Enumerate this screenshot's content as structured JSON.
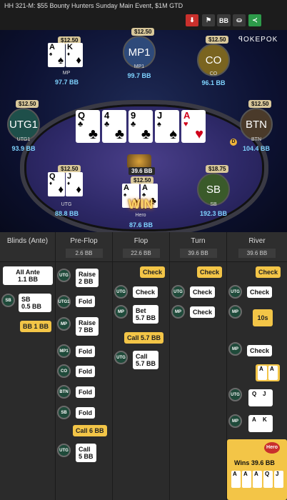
{
  "window": {
    "title": "HH  321-M: $55 Bounty Hunters Sunday Main Event, $1M GTD"
  },
  "toolbar": {
    "bb_label": "BB",
    "brand": "ꟼOKEPOK"
  },
  "players": [
    {
      "pos": "MP",
      "stack": "$12.50",
      "bb": "97.7 BB"
    },
    {
      "pos": "MP1",
      "stack": "$12.50",
      "bb": "99.7 BB"
    },
    {
      "pos": "CO",
      "stack": "$12.50",
      "bb": "96.1 BB"
    },
    {
      "pos": "UTG1",
      "stack": "$12.50",
      "bb": "93.9 BB"
    },
    {
      "pos": "BTN",
      "stack": "$12.50",
      "bb": "104.4 BB"
    },
    {
      "pos": "UTG",
      "stack": "$12.50",
      "bb": "88.8 BB"
    },
    {
      "pos": "Hero",
      "stack": "$12.50",
      "bb": "87.6 BB"
    },
    {
      "pos": "SB",
      "stack": "$18.75",
      "bb": "192.3 BB"
    }
  ],
  "dealer": "D",
  "pot": "39.6 BB",
  "win": "WIN",
  "board": [
    {
      "r": "Q",
      "s": "♣"
    },
    {
      "r": "4",
      "s": "♣"
    },
    {
      "r": "9",
      "s": "♣"
    },
    {
      "r": "J",
      "s": "♠"
    },
    {
      "r": "A",
      "s": "♥"
    }
  ],
  "streets": [
    {
      "name": "Blinds (Ante)",
      "pot": ""
    },
    {
      "name": "Pre-Flop",
      "pot": "2.6 BB"
    },
    {
      "name": "Flop",
      "pot": "22.6 BB"
    },
    {
      "name": "Turn",
      "pot": "39.6 BB"
    },
    {
      "name": "River",
      "pot": "39.6 BB"
    }
  ],
  "blinds": {
    "all_ante": "All Ante\n1.1 BB",
    "sb_chip": "SB",
    "sb": "SB\n0.5 BB",
    "bb": "BB 1 BB"
  },
  "preflop": [
    {
      "chip": "UTG",
      "act": "Raise\n2 BB"
    },
    {
      "chip": "UTG1",
      "act": "Fold"
    },
    {
      "chip": "MP",
      "act": "Raise\n7 BB"
    },
    {
      "chip": "MP1",
      "act": "Fold"
    },
    {
      "chip": "CO",
      "act": "Fold"
    },
    {
      "chip": "BTN",
      "act": "Fold"
    },
    {
      "chip": "SB",
      "act": "Fold"
    },
    {
      "yel": "Call 6 BB"
    },
    {
      "chip": "UTG",
      "act": "Call\n5 BB"
    }
  ],
  "flop": [
    {
      "yel": "Check"
    },
    {
      "chip": "UTG",
      "act": "Check"
    },
    {
      "chip": "MP",
      "act": "Bet\n5.7 BB"
    },
    {
      "yel": "Call 5.7 BB"
    },
    {
      "chip": "UTG",
      "act": "Call\n5.7 BB"
    }
  ],
  "turn": [
    {
      "yel": "Check"
    },
    {
      "chip": "UTG",
      "act": "Check"
    },
    {
      "chip": "MP",
      "act": "Check"
    }
  ],
  "river": [
    {
      "yel": "Check"
    },
    {
      "chip": "UTG",
      "act": "Check"
    },
    {
      "chip": "MP",
      "act": "10s"
    },
    {
      "chip": "MP",
      "act": "Check"
    }
  ],
  "result": {
    "hero": "Hero",
    "wins": "Wins 39.6 BB"
  }
}
